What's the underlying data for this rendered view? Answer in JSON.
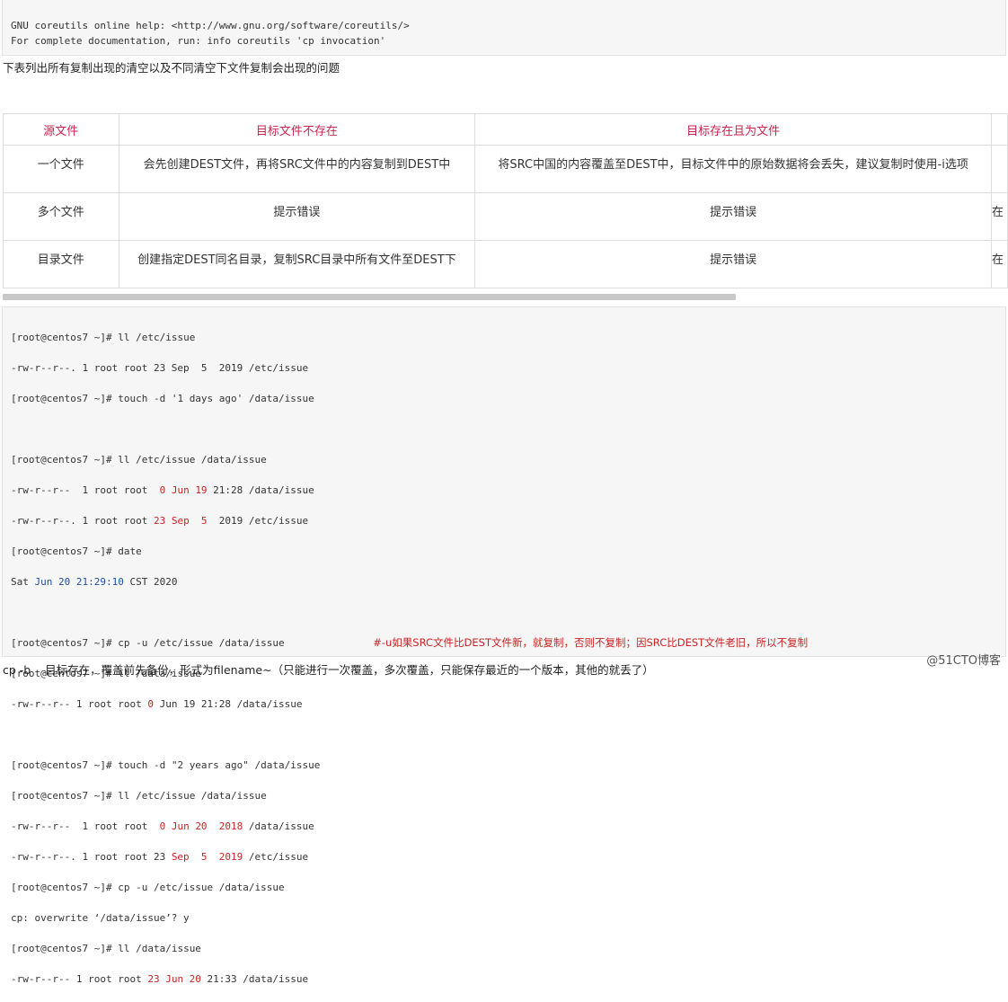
{
  "help_block": {
    "line1": "GNU coreutils online help: <http://www.gnu.org/software/coreutils/>",
    "line2": "For complete documentation, run: info coreutils 'cp invocation'"
  },
  "intro_text": "下表列出所有复制出现的清空以及不同清空下文件复制会出现的问题",
  "table": {
    "headers": [
      "源文件",
      "目标文件不存在",
      "目标存在且为文件",
      ""
    ],
    "rows": [
      [
        "一个文件",
        "会先创建DEST文件，再将SRC文件中的内容复制到DEST中",
        "将SRC中国的内容覆盖至DEST中，目标文件中的原始数据将会丢失，建议复制时使用-i选项",
        ""
      ],
      [
        "多个文件",
        "提示错误",
        "提示错误",
        "在"
      ],
      [
        "目录文件",
        "创建指定DEST同名目录，复制SRC目录中所有文件至DEST下",
        "提示错误",
        "在"
      ]
    ]
  },
  "terminal": {
    "p": "[root@centos7 ~]# ",
    "l1_cmd": "ll /etc/issue",
    "l2": "-rw-r--r--. 1 root root 23 Sep  5  2019 /etc/issue",
    "l3_cmd": "touch -d '1 days ago' /data/issue",
    "l5_cmd": "ll /etc/issue /data/issue",
    "l6_pre": "-rw-r--r--  1 root root  ",
    "l6_red": "0 Jun 19",
    "l6_post": " 21:28 /data/issue",
    "l7_pre": "-rw-r--r--. 1 root root ",
    "l7_red": "23 Sep  5",
    "l7_post": "  2019 /etc/issue",
    "l8_cmd": "date",
    "l9_pre": "Sat ",
    "l9_blue": "Jun 20 21:29:10",
    "l9_post": " CST 2020",
    "l11_cmd": "cp -u /etc/issue /data/issue",
    "l11_comment": "#-u如果SRC文件比DEST文件新，就复制，否则不复制；因SRC比DEST文件老旧，所以不复制",
    "l12_cmd": "ll /data/issue",
    "l13_pre": "-rw-r--r-- 1 root root ",
    "l13_red": "0",
    "l13_post": " Jun 19 21:28 /data/issue",
    "l15_cmd": "touch -d \"2 years ago\" /data/issue",
    "l16_cmd": "ll /etc/issue /data/issue",
    "l17_pre": "-rw-r--r--  1 root root  ",
    "l17_red": "0 Jun 20  2018",
    "l17_post": " /data/issue",
    "l18_pre": "-rw-r--r--. 1 root root 23 ",
    "l18_red": "Sep  5  2019",
    "l18_post": " /etc/issue",
    "l19_cmd": "cp -u /etc/issue /data/issue",
    "l20": "cp: overwrite ‘/data/issue’? y",
    "l21_cmd": "ll /data/issue",
    "l22_pre": "-rw-r--r-- 1 root root ",
    "l22_red": "23 Jun 20",
    "l22_post": " 21:33 /data/issue"
  },
  "footer_text": "cp -b    目标存在，覆盖前先备份，形式为filename~（只能进行一次覆盖，多次覆盖，只能保存最近的一个版本，其他的就丢了）",
  "watermark": "@51CTO博客"
}
